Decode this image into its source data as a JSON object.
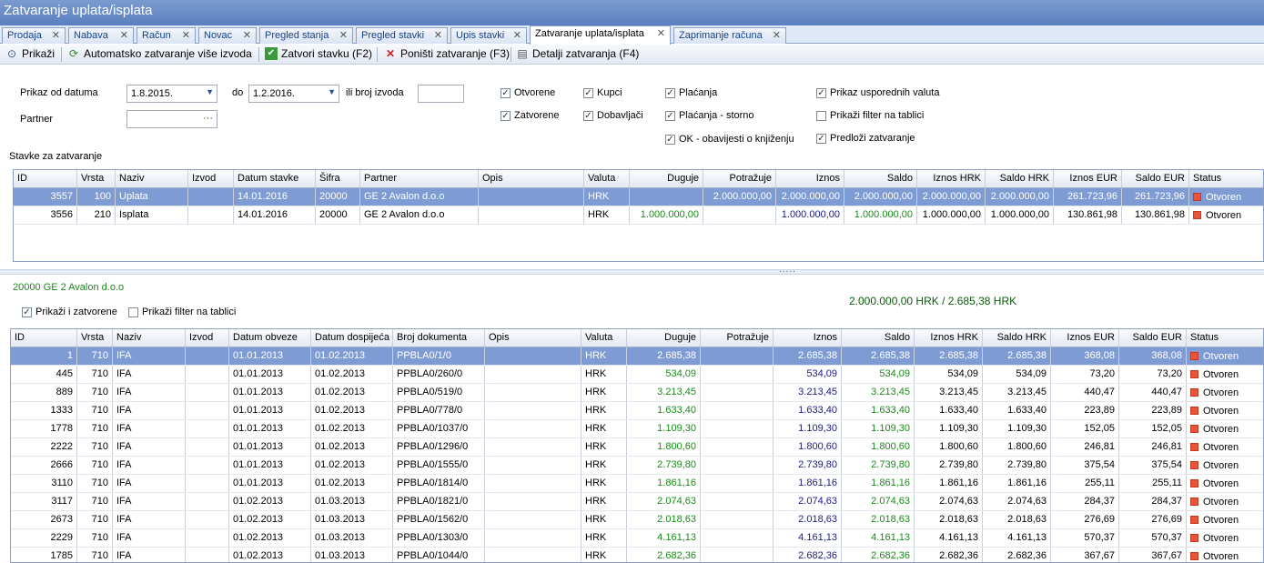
{
  "window": {
    "title": "Zatvaranje uplata/isplata"
  },
  "tabs": [
    "Prodaja",
    "Nabava",
    "Račun",
    "Novac",
    "Pregled stanja",
    "Pregled stavki",
    "Upis stavki",
    "Zatvaranje uplata/isplata",
    "Zaprimanje računa"
  ],
  "toolbar": {
    "show": "Prikaži",
    "auto_close": "Automatsko zatvaranje više izvoda",
    "close_item": "Zatvori stavku (F2)",
    "cancel_close": "Poništi zatvaranje (F3)",
    "close_details": "Detalji zatvaranja (F4)"
  },
  "filter": {
    "from_label": "Prikaz od datuma",
    "from_value": "1.8.2015.",
    "to_label": "do",
    "to_value": "1.2.2016.",
    "statement_label": "ili broj izvoda",
    "statement_value": "",
    "partner_label": "Partner",
    "partner_btn": "···",
    "checks": {
      "otvorene": "Otvorene",
      "zatvorene": "Zatvorene",
      "kupci": "Kupci",
      "dobavljaci": "Dobavljači",
      "placanja": "Plaćanja",
      "placanja_storno": "Plaćanja - storno",
      "ok_obavijesti": "OK - obavijesti o knjiženju",
      "usporedne_valute": "Prikaz usporednih valuta",
      "filter_tablici": "Prikaži filter na tablici",
      "predlozi": "Predloži zatvaranje"
    }
  },
  "top_section": {
    "title": "Stavke za zatvaranje"
  },
  "top_grid": {
    "columns": [
      "ID",
      "Vrsta",
      "Naziv",
      "Izvod",
      "Datum stavke",
      "Šifra",
      "Partner",
      "Opis",
      "Valuta",
      "Duguje",
      "Potražuje",
      "Iznos",
      "Saldo",
      "Iznos HRK",
      "Saldo HRK",
      "Iznos EUR",
      "Saldo EUR",
      "Status"
    ],
    "rows": [
      [
        "3557",
        "100",
        "Uplata",
        "",
        "14.01.2016",
        "20000",
        "GE 2 Avalon d.o.o",
        "",
        "HRK",
        "",
        "2.000.000,00",
        "2.000.000,00",
        "2.000.000,00",
        "2.000.000,00",
        "2.000.000,00",
        "261.723,96",
        "261.723,96",
        "Otvoren"
      ],
      [
        "3556",
        "210",
        "Isplata",
        "",
        "14.01.2016",
        "20000",
        "GE 2 Avalon d.o.o",
        "",
        "HRK",
        "1.000.000,00",
        "",
        "1.000.000,00",
        "1.000.000,00",
        "1.000.000,00",
        "1.000.000,00",
        "130.861,98",
        "130.861,98",
        "Otvoren"
      ]
    ]
  },
  "bottom_section": {
    "partner": "20000 GE 2 Avalon d.o.o",
    "summary": "2.000.000,00 HRK / 2.685,38 HRK",
    "show_closed": "Prikaži i zatvorene",
    "show_filter": "Prikaži filter na tablici"
  },
  "bottom_grid": {
    "columns": [
      "ID",
      "Vrsta",
      "Naziv",
      "Izvod",
      "Datum obveze",
      "Datum dospijeća",
      "Broj dokumenta",
      "Opis",
      "Valuta",
      "Duguje",
      "Potražuje",
      "Iznos",
      "Saldo",
      "Iznos HRK",
      "Saldo HRK",
      "Iznos EUR",
      "Saldo EUR",
      "Status"
    ],
    "rows": [
      [
        "1",
        "710",
        "IFA",
        "",
        "01.01.2013",
        "01.02.2013",
        "PPBLA0/1/0",
        "",
        "HRK",
        "2.685,38",
        "",
        "2.685,38",
        "2.685,38",
        "2.685,38",
        "2.685,38",
        "368,08",
        "368,08",
        "Otvoren"
      ],
      [
        "445",
        "710",
        "IFA",
        "",
        "01.01.2013",
        "01.02.2013",
        "PPBLA0/260/0",
        "",
        "HRK",
        "534,09",
        "",
        "534,09",
        "534,09",
        "534,09",
        "534,09",
        "73,20",
        "73,20",
        "Otvoren"
      ],
      [
        "889",
        "710",
        "IFA",
        "",
        "01.01.2013",
        "01.02.2013",
        "PPBLA0/519/0",
        "",
        "HRK",
        "3.213,45",
        "",
        "3.213,45",
        "3.213,45",
        "3.213,45",
        "3.213,45",
        "440,47",
        "440,47",
        "Otvoren"
      ],
      [
        "1333",
        "710",
        "IFA",
        "",
        "01.01.2013",
        "01.02.2013",
        "PPBLA0/778/0",
        "",
        "HRK",
        "1.633,40",
        "",
        "1.633,40",
        "1.633,40",
        "1.633,40",
        "1.633,40",
        "223,89",
        "223,89",
        "Otvoren"
      ],
      [
        "1778",
        "710",
        "IFA",
        "",
        "01.01.2013",
        "01.02.2013",
        "PPBLA0/1037/0",
        "",
        "HRK",
        "1.109,30",
        "",
        "1.109,30",
        "1.109,30",
        "1.109,30",
        "1.109,30",
        "152,05",
        "152,05",
        "Otvoren"
      ],
      [
        "2222",
        "710",
        "IFA",
        "",
        "01.01.2013",
        "01.02.2013",
        "PPBLA0/1296/0",
        "",
        "HRK",
        "1.800,60",
        "",
        "1.800,60",
        "1.800,60",
        "1.800,60",
        "1.800,60",
        "246,81",
        "246,81",
        "Otvoren"
      ],
      [
        "2666",
        "710",
        "IFA",
        "",
        "01.01.2013",
        "01.02.2013",
        "PPBLA0/1555/0",
        "",
        "HRK",
        "2.739,80",
        "",
        "2.739,80",
        "2.739,80",
        "2.739,80",
        "2.739,80",
        "375,54",
        "375,54",
        "Otvoren"
      ],
      [
        "3110",
        "710",
        "IFA",
        "",
        "01.01.2013",
        "01.02.2013",
        "PPBLA0/1814/0",
        "",
        "HRK",
        "1.861,16",
        "",
        "1.861,16",
        "1.861,16",
        "1.861,16",
        "1.861,16",
        "255,11",
        "255,11",
        "Otvoren"
      ],
      [
        "3117",
        "710",
        "IFA",
        "",
        "01.02.2013",
        "01.03.2013",
        "PPBLA0/1821/0",
        "",
        "HRK",
        "2.074,63",
        "",
        "2.074,63",
        "2.074,63",
        "2.074,63",
        "2.074,63",
        "284,37",
        "284,37",
        "Otvoren"
      ],
      [
        "2673",
        "710",
        "IFA",
        "",
        "01.02.2013",
        "01.03.2013",
        "PPBLA0/1562/0",
        "",
        "HRK",
        "2.018,63",
        "",
        "2.018,63",
        "2.018,63",
        "2.018,63",
        "2.018,63",
        "276,69",
        "276,69",
        "Otvoren"
      ],
      [
        "2229",
        "710",
        "IFA",
        "",
        "01.02.2013",
        "01.03.2013",
        "PPBLA0/1303/0",
        "",
        "HRK",
        "4.161,13",
        "",
        "4.161,13",
        "4.161,13",
        "4.161,13",
        "4.161,13",
        "570,37",
        "570,37",
        "Otvoren"
      ],
      [
        "1785",
        "710",
        "IFA",
        "",
        "01.02.2013",
        "01.03.2013",
        "PPBLA0/1044/0",
        "",
        "HRK",
        "2.682,36",
        "",
        "2.682,36",
        "2.682,36",
        "2.682,36",
        "2.682,36",
        "367,67",
        "367,67",
        "Otvoren"
      ]
    ]
  },
  "colors": {
    "selected_row": "#7f9bd4",
    "green_value": "#1a8a1a",
    "blue_value": "#1a1a8a",
    "status_open": "#e6553a"
  }
}
